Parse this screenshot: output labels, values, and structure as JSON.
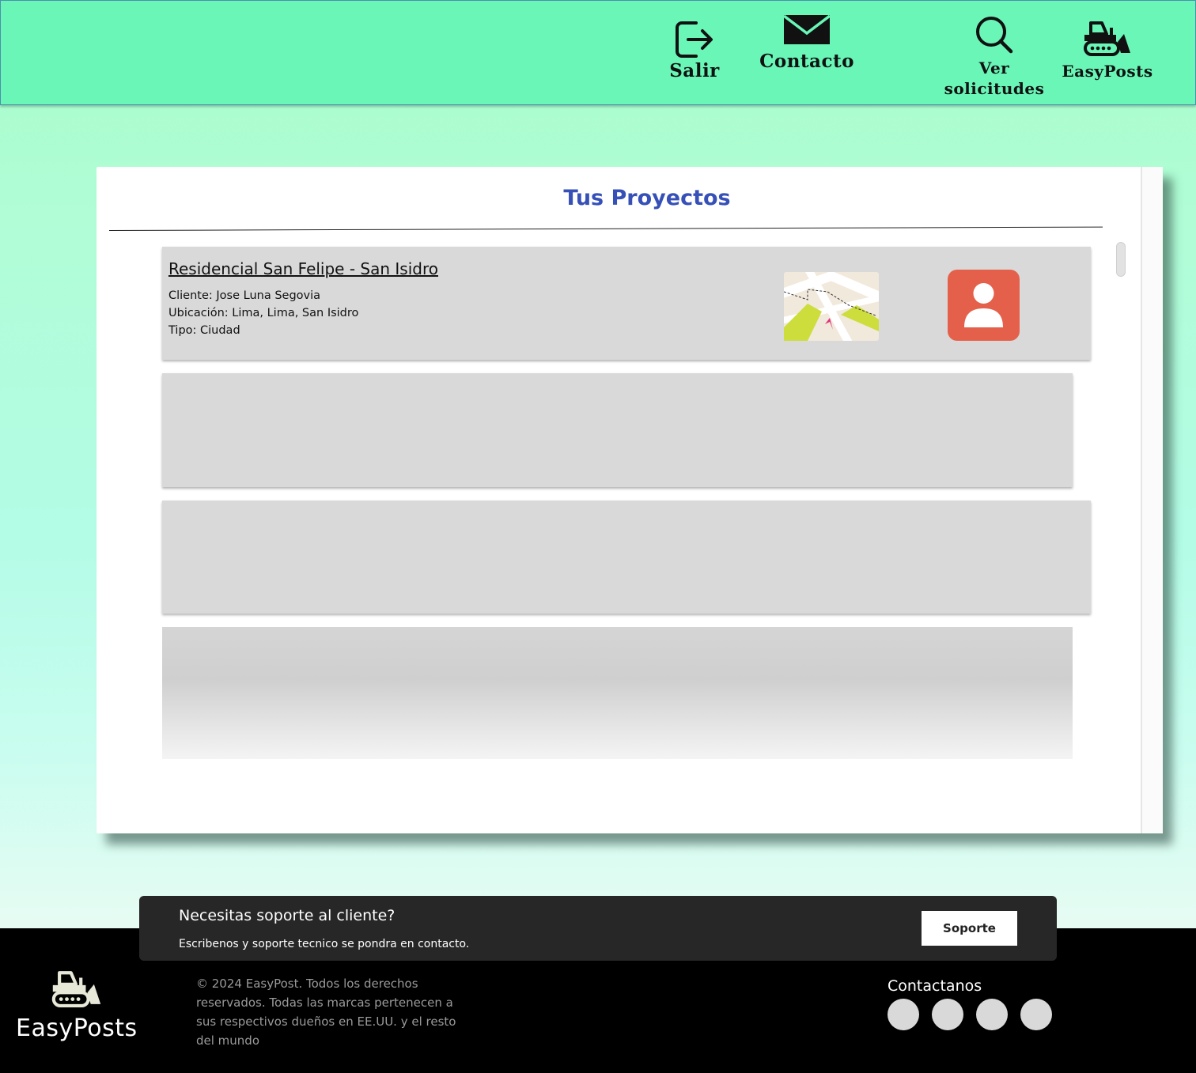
{
  "header": {
    "nav": [
      {
        "label": "Salir",
        "icon": "logout-icon"
      },
      {
        "label": "Contacto",
        "icon": "envelope-icon"
      },
      {
        "label": "Ver solicitudes",
        "icon": "search-icon"
      },
      {
        "label": "EasyPosts",
        "icon": "bulldozer-icon"
      }
    ]
  },
  "main": {
    "title": "Tus Proyectos",
    "projects": [
      {
        "name": "Residencial San Felipe - San Isidro",
        "cliente": "Cliente: Jose Luna Segovia",
        "ubicacion": "Ubicación: Lima, Lima, San Isidro",
        "tipo": "Tipo: Ciudad"
      }
    ]
  },
  "support": {
    "title": "Necesitas soporte al cliente?",
    "subtitle": "Escribenos y soporte tecnico se pondra en contacto.",
    "button": "Soporte"
  },
  "footer": {
    "brand": "EasyPosts",
    "copyright": "© 2024 EasyPost. Todos los derechos reservados. Todas las marcas pertenecen a sus respectivos dueños en EE.UU. y el resto del mundo",
    "contact_title": "Contactanos"
  },
  "colors": {
    "header_bg": "#69f6b7",
    "title_blue": "#3650b8",
    "avatar_red": "#e5604b",
    "card_gray": "#d9d9d9",
    "support_bg": "#272727",
    "footer_bg": "#000000"
  }
}
